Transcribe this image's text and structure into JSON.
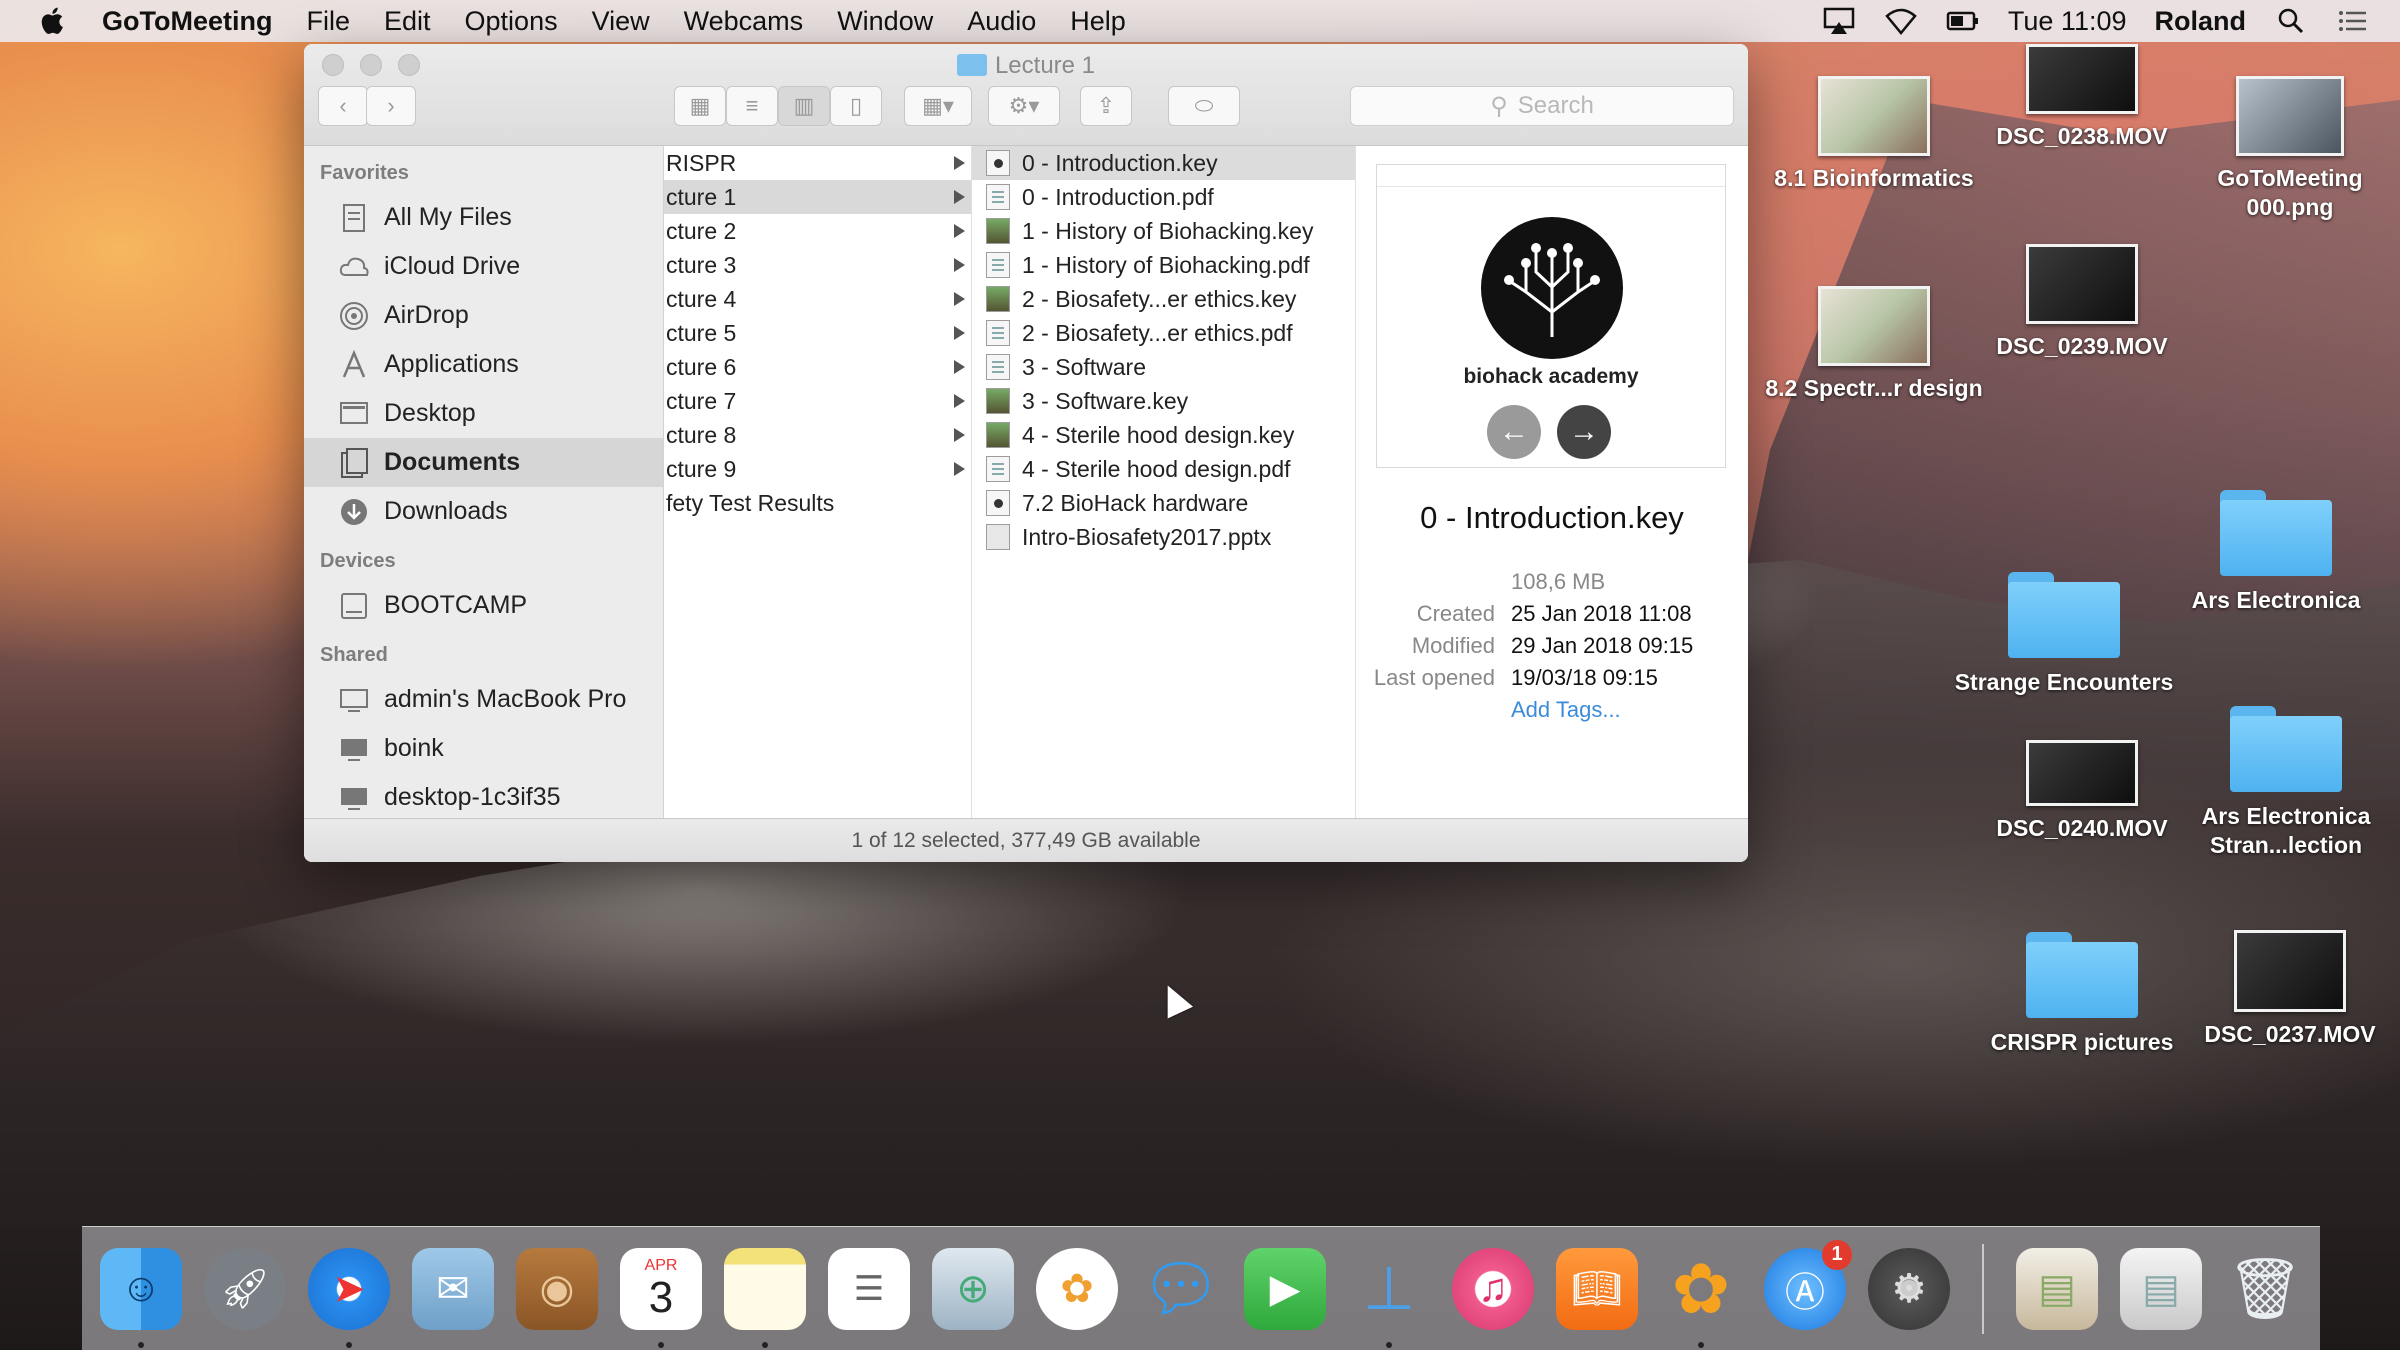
{
  "menubar": {
    "app_name": "GoToMeeting",
    "items": [
      "File",
      "Edit",
      "Options",
      "View",
      "Webcams",
      "Window",
      "Audio",
      "Help"
    ],
    "clock": "Tue 11:09",
    "user": "Roland"
  },
  "window": {
    "title": "Lecture 1",
    "search_placeholder": "Search",
    "status": "1 of 12 selected, 377,49 GB available"
  },
  "sidebar": {
    "favorites_header": "Favorites",
    "favorites": [
      "All My Files",
      "iCloud Drive",
      "AirDrop",
      "Applications",
      "Desktop",
      "Documents",
      "Downloads"
    ],
    "devices_header": "Devices",
    "devices": [
      "BOOTCAMP"
    ],
    "shared_header": "Shared",
    "shared": [
      "admin's MacBook Pro",
      "boink",
      "desktop-1c3if35"
    ]
  },
  "column1": [
    "RISPR",
    "cture 1",
    "cture 2",
    "cture 3",
    "cture 4",
    "cture 5",
    "cture 6",
    "cture 7",
    "cture 8",
    "cture 9",
    "fety Test Results"
  ],
  "column2": [
    {
      "name": "0 - Introduction.key",
      "type": "key"
    },
    {
      "name": "0 - Introduction.pdf",
      "type": "pdf"
    },
    {
      "name": "1 - History of Biohacking.key",
      "type": "img"
    },
    {
      "name": "1 - History of Biohacking.pdf",
      "type": "pdf"
    },
    {
      "name": "2 - Biosafety...er ethics.key",
      "type": "img"
    },
    {
      "name": "2 - Biosafety...er ethics.pdf",
      "type": "pdf"
    },
    {
      "name": "3 - Software",
      "type": "pdf"
    },
    {
      "name": "3 - Software.key",
      "type": "img"
    },
    {
      "name": "4 - Sterile hood design.key",
      "type": "img"
    },
    {
      "name": "4 - Sterile hood design.pdf",
      "type": "pdf"
    },
    {
      "name": "7.2 BioHack hardware",
      "type": "key"
    },
    {
      "name": "Intro-Biosafety2017.pptx",
      "type": "pptx"
    }
  ],
  "preview": {
    "logo_text": "biohack academy",
    "filename": "0 - Introduction.key",
    "size": "108,6 MB",
    "created_label": "Created",
    "created": "25 Jan 2018 11:08",
    "modified_label": "Modified",
    "modified": "29 Jan 2018 09:15",
    "opened_label": "Last opened",
    "opened": "19/03/18 09:15",
    "add_tags": "Add Tags..."
  },
  "desktop": {
    "bioinformatics": "8.1 Bioinformatics",
    "dsc238": "DSC_0238.MOV",
    "gotomeeting_png": "GoToMeeting 000.png",
    "spectr": "8.2 Spectr...r design",
    "dsc239": "DSC_0239.MOV",
    "ars": "Ars Electronica",
    "strange": "Strange Encounters",
    "dsc240": "DSC_0240.MOV",
    "ars_stran": "Ars Electronica Stran...lection",
    "crispr": "CRISPR pictures",
    "dsc237": "DSC_0237.MOV"
  },
  "dock": {
    "calendar_month": "APR",
    "calendar_day": "3",
    "appstore_badge": "1"
  }
}
